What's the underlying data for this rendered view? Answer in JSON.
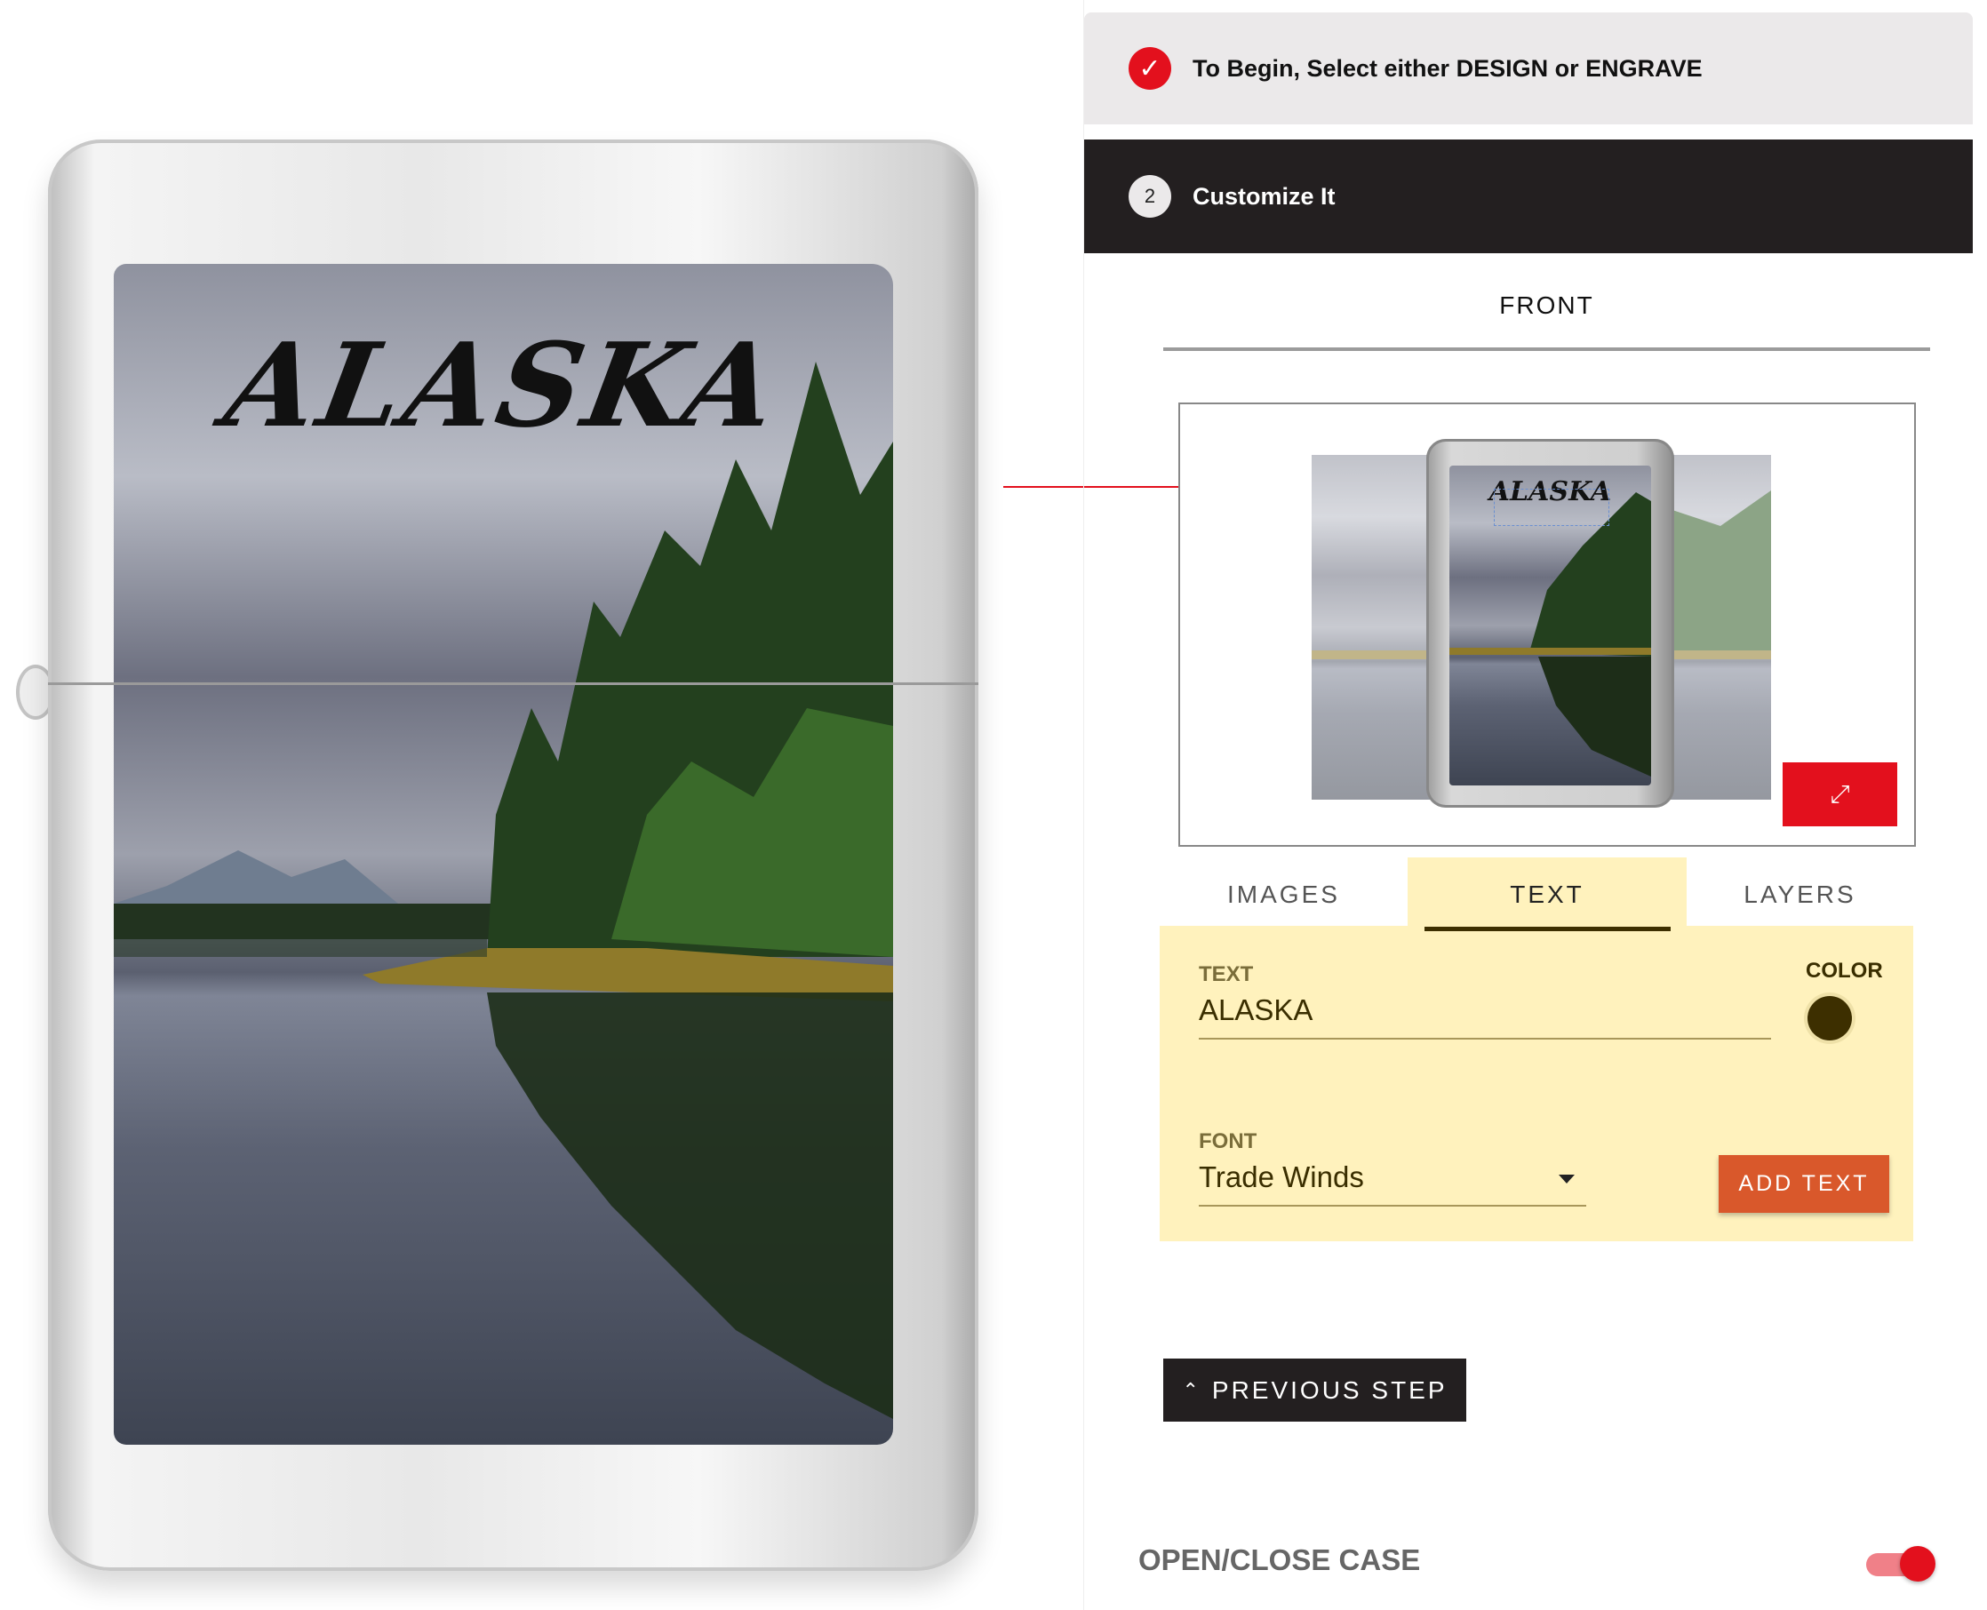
{
  "product": {
    "artwork_text": "ALASKA"
  },
  "steps": [
    {
      "number": "1",
      "status": "complete",
      "icon": "check-icon",
      "label": "To Begin, Select either DESIGN or ENGRAVE"
    },
    {
      "number": "2",
      "status": "active",
      "label": "Customize It"
    }
  ],
  "side_tab": {
    "label": "FRONT"
  },
  "preview": {
    "artwork_text": "ALASKA",
    "expand_icon": "expand-icon"
  },
  "tabs": [
    {
      "label": "IMAGES",
      "active": false
    },
    {
      "label": "TEXT",
      "active": true
    },
    {
      "label": "LAYERS",
      "active": false
    }
  ],
  "text_panel": {
    "text_label": "TEXT",
    "text_value": "ALASKA",
    "color_label": "COLOR",
    "color_value": "#3d2f00",
    "font_label": "FONT",
    "font_value": "Trade Winds",
    "add_button": "ADD TEXT"
  },
  "previous_step": {
    "label": "PREVIOUS STEP",
    "icon": "chevron-up-icon"
  },
  "case_toggle": {
    "label": "OPEN/CLOSE CASE",
    "on": true
  },
  "colors": {
    "accent": "#e3101d",
    "dark": "#231f20",
    "panel": "#fff2bd",
    "button": "#d9582b"
  }
}
